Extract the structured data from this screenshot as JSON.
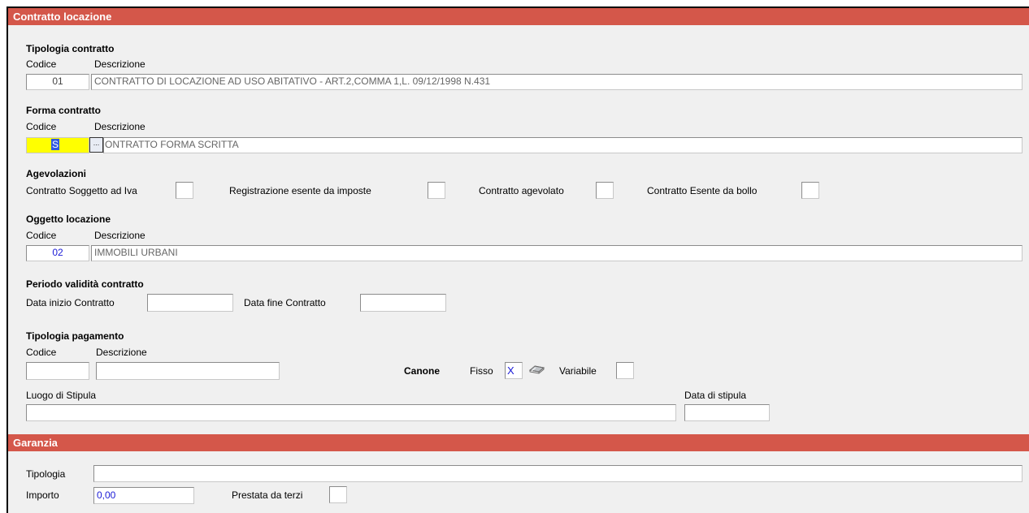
{
  "contratto": {
    "header": "Contratto locazione",
    "tipologia": {
      "title": "Tipologia contratto",
      "codice_label": "Codice",
      "descrizione_label": "Descrizione",
      "codice": "01",
      "descrizione": "CONTRATTO DI LOCAZIONE AD USO ABITATIVO - ART.2,COMMA 1,L. 09/12/1998 N.431"
    },
    "forma": {
      "title": "Forma contratto",
      "codice_label": "Codice",
      "descrizione_label": "Descrizione",
      "codice": "S",
      "lookup_button": "...",
      "descrizione": "ONTRATTO FORMA SCRITTA"
    },
    "agevolazioni": {
      "title": "Agevolazioni",
      "soggetto_iva": "Contratto Soggetto ad Iva",
      "esente_imposte": "Registrazione esente da imposte",
      "agevolato": "Contratto agevolato",
      "esente_bollo": "Contratto Esente da bollo"
    },
    "oggetto": {
      "title": "Oggetto locazione",
      "codice_label": "Codice",
      "descrizione_label": "Descrizione",
      "codice": "02",
      "descrizione": "IMMOBILI URBANI"
    },
    "periodo": {
      "title": "Periodo validità contratto",
      "inizio_label": "Data inizio Contratto",
      "inizio_value": "",
      "fine_label": "Data fine Contratto",
      "fine_value": ""
    },
    "pagamento": {
      "title": "Tipologia pagamento",
      "codice_label": "Codice",
      "descrizione_label": "Descrizione",
      "codice": "",
      "descrizione": "",
      "canone_label": "Canone",
      "fisso_label": "Fisso",
      "fisso_value": "X",
      "variabile_label": "Variabile",
      "variabile_value": ""
    },
    "stipula": {
      "luogo_label": "Luogo di Stipula",
      "luogo_value": "",
      "data_label": "Data di stipula",
      "data_value": ""
    }
  },
  "garanzia": {
    "header": "Garanzia",
    "tipologia_label": "Tipologia",
    "tipologia_value": "",
    "importo_label": "Importo",
    "importo_value": "0,00",
    "terzi_label": "Prestata da terzi"
  },
  "icons": {
    "pencil": "pencil-icon"
  },
  "colors": {
    "header_bg": "#d4574a",
    "panel_bg": "#f0f0f0",
    "highlight": "#ffff00",
    "value_blue": "#1a1ad6"
  }
}
